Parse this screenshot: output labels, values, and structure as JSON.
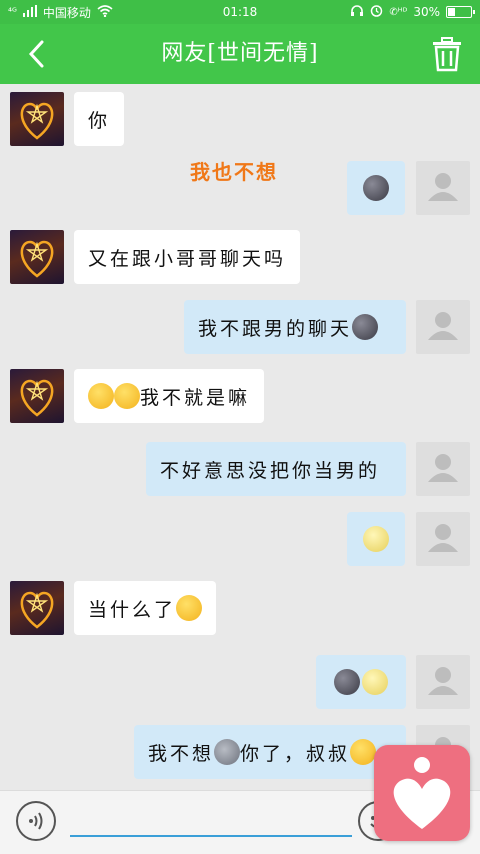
{
  "status_bar": {
    "carrier": "中国移动",
    "time": "01:18",
    "battery": "30%",
    "icons": [
      "sim-icon",
      "signal-icon",
      "wifi-icon",
      "headset-icon",
      "alarm-icon",
      "hd-call-icon",
      "battery-icon"
    ]
  },
  "header": {
    "title": "网友[世间无情]",
    "back_icon": "back-chevron-icon",
    "delete_icon": "trash-icon"
  },
  "colors": {
    "header_green": "#42c64a",
    "status_green": "#3fbf47",
    "incoming_bubble": "#ffffff",
    "outgoing_bubble": "#d2e9f8",
    "system_text": "#f07818",
    "background": "#e9e9e9",
    "input_underline": "#3a9fd8",
    "float_icon": "#ee6f80"
  },
  "system_message": "我也不想",
  "messages": [
    {
      "side": "in",
      "text": "你"
    },
    {
      "side": "out",
      "text": "",
      "emoji": [
        "new-moon-face-emoji"
      ]
    },
    {
      "side": "in",
      "text": "又在跟小哥哥聊天吗"
    },
    {
      "side": "out",
      "text": "我不跟男的聊天",
      "emoji": [
        "new-moon-face-emoji"
      ]
    },
    {
      "side": "in",
      "text": "我不就是嘛",
      "emoji": [
        "winking-tongue-emoji",
        "winking-tongue-emoji"
      ]
    },
    {
      "side": "out",
      "text": "不好意思没把你当男的"
    },
    {
      "side": "out",
      "text": "",
      "emoji": [
        "full-moon-face-emoji"
      ]
    },
    {
      "side": "in",
      "text": "当什么了",
      "emoji": [
        "tears-of-joy-emoji"
      ]
    },
    {
      "side": "out",
      "text": "",
      "emoji": [
        "new-moon-face-emoji",
        "full-moon-face-emoji"
      ]
    },
    {
      "side": "out",
      "text_a": "我不想",
      "text_b": "你了，叔叔",
      "emoji": [
        "pigeon-emoji",
        "smile-emoji"
      ]
    }
  ],
  "input": {
    "value": "",
    "placeholder": ""
  },
  "floating_icon": "heart-app-icon"
}
